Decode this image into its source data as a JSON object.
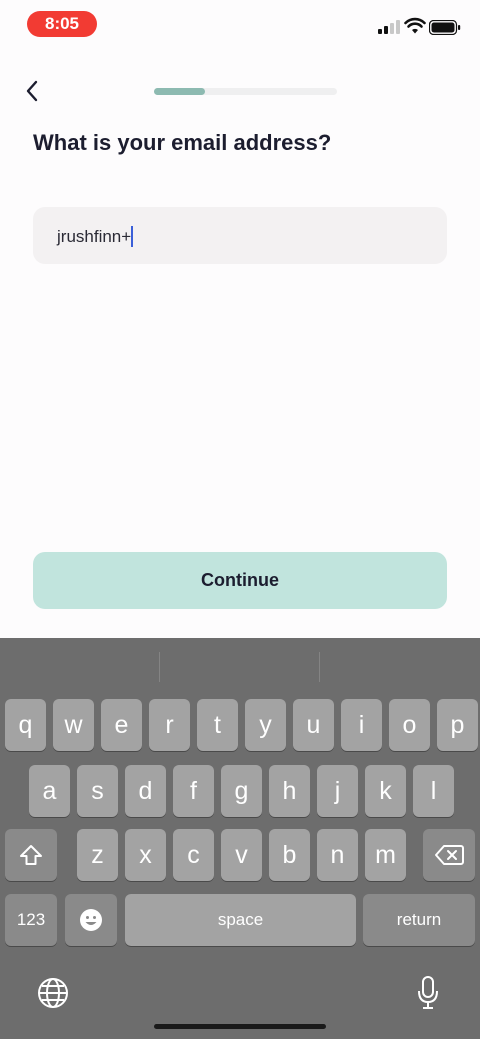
{
  "status_bar": {
    "time": "8:05"
  },
  "header": {
    "progress_fraction": 0.28
  },
  "question": "What is your email address?",
  "email_field": {
    "value": "jrushfinn+"
  },
  "continue_label": "Continue",
  "keyboard": {
    "row1": [
      "q",
      "w",
      "e",
      "r",
      "t",
      "y",
      "u",
      "i",
      "o",
      "p"
    ],
    "row2": [
      "a",
      "s",
      "d",
      "f",
      "g",
      "h",
      "j",
      "k",
      "l"
    ],
    "row3": [
      "z",
      "x",
      "c",
      "v",
      "b",
      "n",
      "m"
    ],
    "numbers_label": "123",
    "space_label": "space",
    "return_label": "return"
  },
  "colors": {
    "accent": "#8dbab1",
    "button": "#c1e4dd",
    "time_pill": "#f23b33"
  }
}
